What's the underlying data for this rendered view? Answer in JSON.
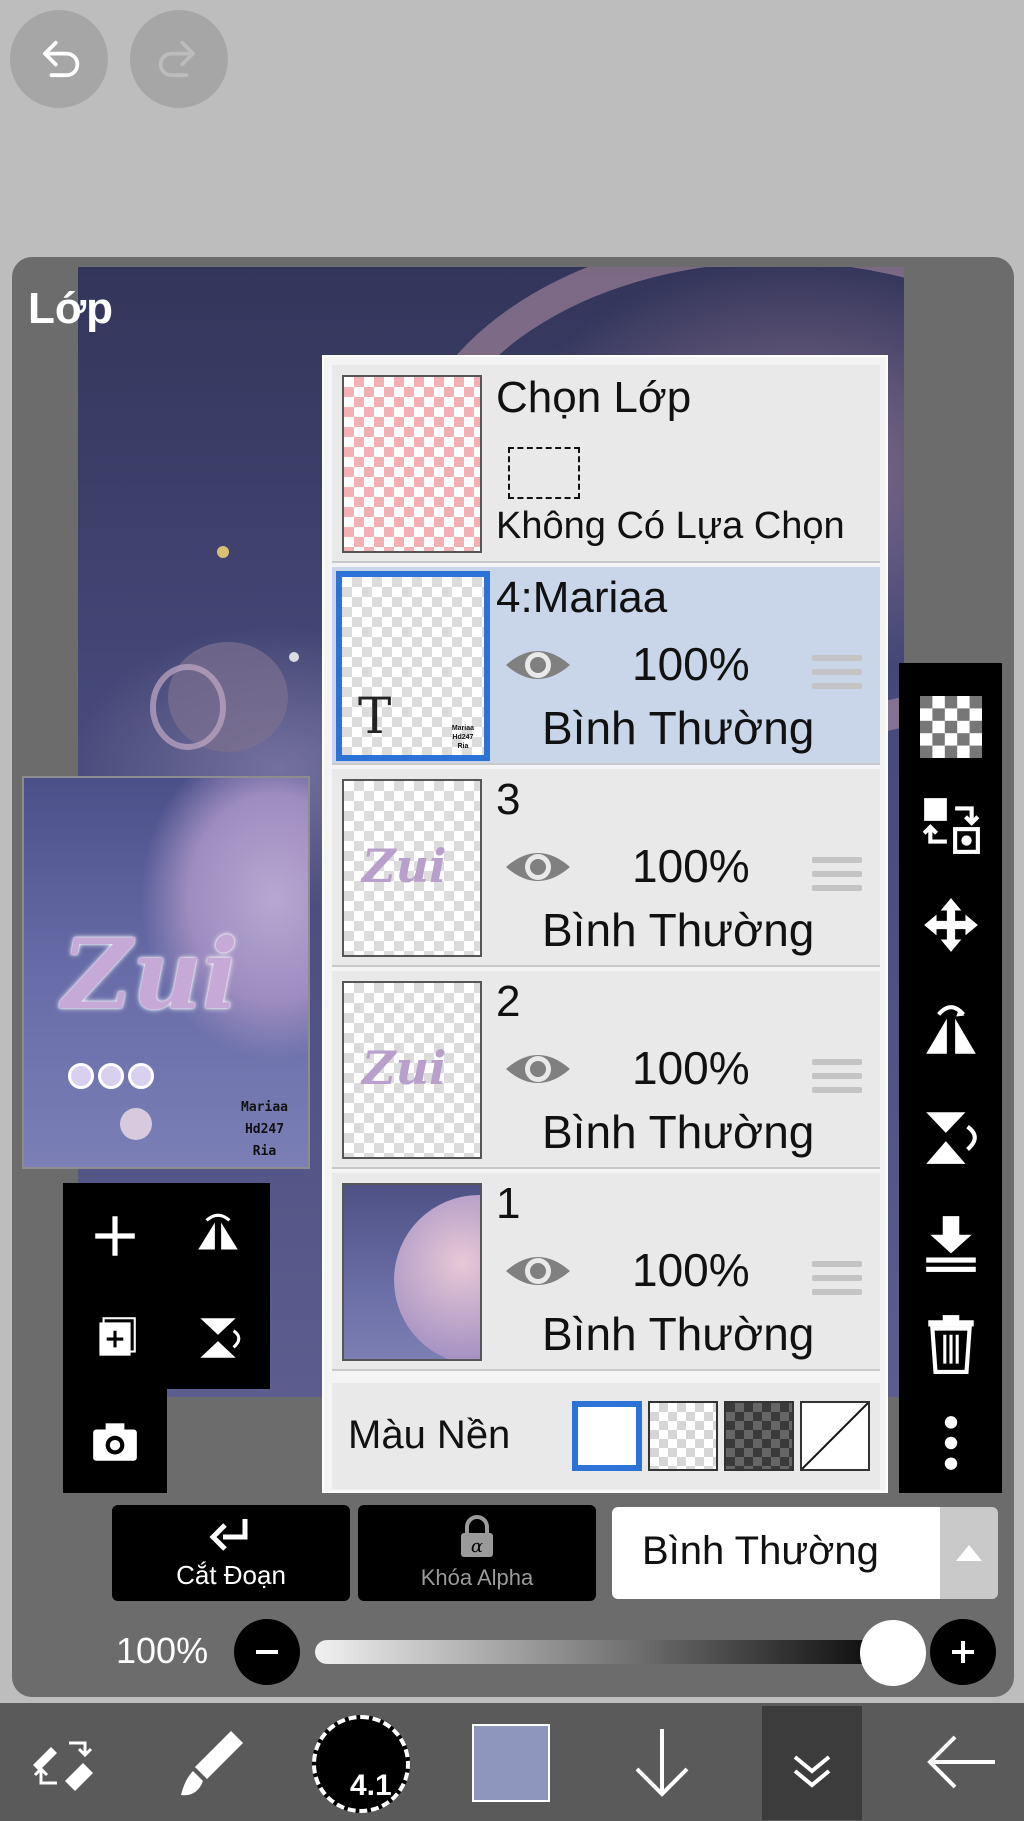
{
  "panel": {
    "title": "Lớp"
  },
  "selection_layer": {
    "title": "Chọn Lớp",
    "status": "Không Có Lựa Chọn"
  },
  "layers": [
    {
      "name": "4:Mariaa",
      "opacity": "100%",
      "blend": "Bình Thường",
      "selected": true,
      "type_icon": "T",
      "credit": "Mariaa\nHd247\nRia"
    },
    {
      "name": "3",
      "opacity": "100%",
      "blend": "Bình Thường",
      "selected": false
    },
    {
      "name": "2",
      "opacity": "100%",
      "blend": "Bình Thường",
      "selected": false
    },
    {
      "name": "1",
      "opacity": "100%",
      "blend": "Bình Thường",
      "selected": false
    }
  ],
  "background": {
    "label": "Màu Nền",
    "options": [
      "white",
      "transparent-light",
      "transparent-dark",
      "none"
    ],
    "selected": "white"
  },
  "thumbnail": {
    "art_text": "Zui",
    "credit_lines": [
      "Mariaa",
      "Hd247",
      "Ria"
    ]
  },
  "actions": {
    "clip_label": "Cắt Đoạn",
    "alpha_lock_label": "Khóa Alpha",
    "blend_mode": "Bình Thường"
  },
  "opacity": {
    "value_label": "100%",
    "value": 1.0
  },
  "toolbar": {
    "brush_size": "4.1",
    "color": "#8e96bd"
  },
  "colors": {
    "accent": "#2d72d6",
    "selected_row": "#c9d6ea",
    "panel": "#6c6c6c"
  }
}
